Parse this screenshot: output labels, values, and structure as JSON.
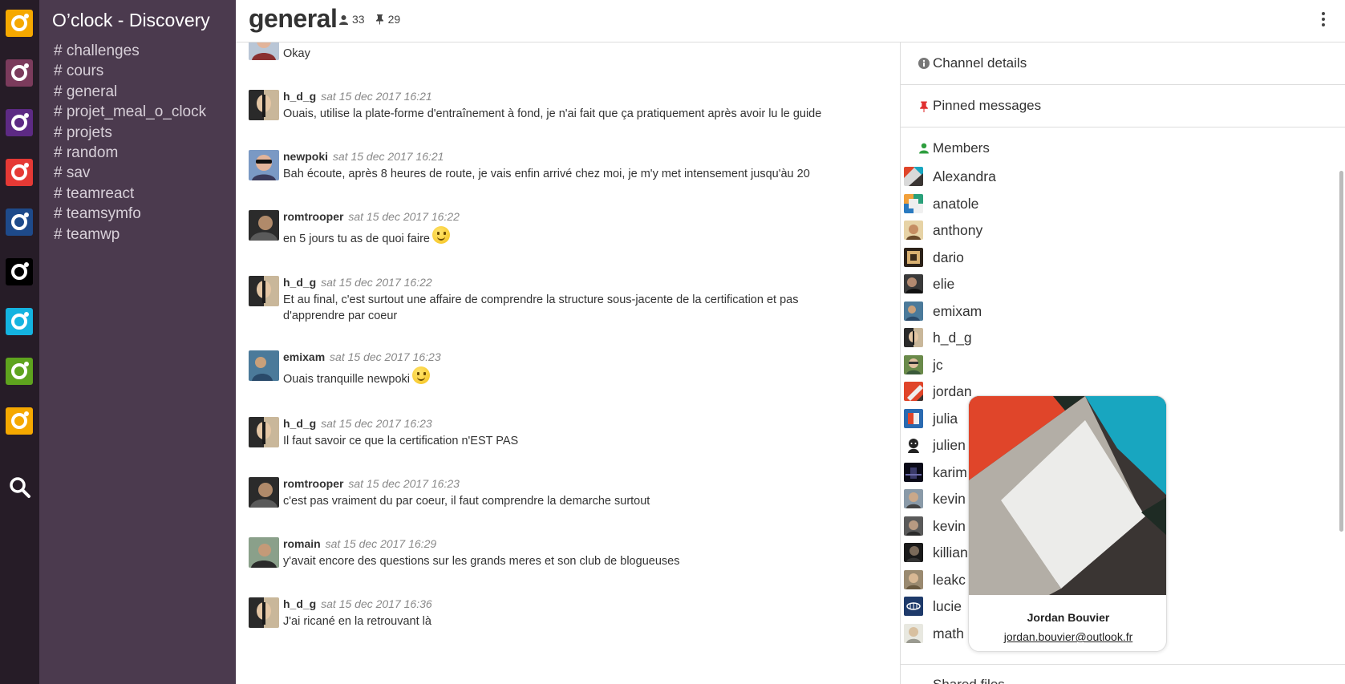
{
  "rail": {
    "teams": [
      {
        "name": "team-1",
        "color": "#f5a800"
      },
      {
        "name": "team-2",
        "color": "#7b3b5c"
      },
      {
        "name": "team-3",
        "color": "#5d2a84"
      },
      {
        "name": "team-4",
        "color": "#e53935"
      },
      {
        "name": "team-5",
        "color": "#1e4a8a"
      },
      {
        "name": "team-6",
        "color": "#000000"
      },
      {
        "name": "team-7",
        "color": "#14b3e0"
      },
      {
        "name": "team-8",
        "color": "#5ea31e"
      },
      {
        "name": "team-9",
        "color": "#f5a800"
      }
    ],
    "search_icon": "search-icon"
  },
  "sidebar": {
    "team_name": "O’clock - Discovery",
    "channels": [
      {
        "label": "# challenges"
      },
      {
        "label": "# cours"
      },
      {
        "label": "# general"
      },
      {
        "label": "# projet_meal_o_clock"
      },
      {
        "label": "# projets"
      },
      {
        "label": "# random"
      },
      {
        "label": "# sav"
      },
      {
        "label": "# teamreact"
      },
      {
        "label": "# teamsymfo"
      },
      {
        "label": "# teamwp"
      }
    ]
  },
  "header": {
    "title": "general",
    "members_count": "33",
    "pinned_count": "29",
    "menu_icon": "kebab-menu-icon"
  },
  "messages": [
    {
      "author": "",
      "time": "",
      "text": "Okay"
    },
    {
      "author": "h_d_g",
      "time": "sat 15 dec 2017 16:21",
      "text": "Ouais, utilise la plate-forme d'entraînement à fond, je n'ai fait que ça pratiquement après avoir lu le guide"
    },
    {
      "author": "newpoki",
      "time": "sat 15 dec 2017 16:21",
      "text": "Bah écoute, après 8 heures de route, je vais enfin arrivé chez moi, je m'y met intensement jusqu'àu 20"
    },
    {
      "author": "romtrooper",
      "time": "sat 15 dec 2017 16:22",
      "text": "en 5 jours tu as de quoi faire",
      "emoji": true
    },
    {
      "author": "h_d_g",
      "time": "sat 15 dec 2017 16:22",
      "text": "Et au final, c'est surtout une affaire de comprendre la structure sous-jacente de la certification et pas d'apprendre par coeur"
    },
    {
      "author": "emixam",
      "time": "sat 15 dec 2017 16:23",
      "text": "Ouais tranquille newpoki",
      "emoji": true
    },
    {
      "author": "h_d_g",
      "time": "sat 15 dec 2017 16:23",
      "text": "Il faut savoir ce que la certification n'EST PAS"
    },
    {
      "author": "romtrooper",
      "time": "sat 15 dec 2017 16:23",
      "text": "c'est pas vraiment du par coeur, il faut comprendre la demarche surtout"
    },
    {
      "author": "romain",
      "time": "sat 15 dec 2017 16:29",
      "text": "y'avait encore des questions sur les grands meres et son club de blogueuses"
    },
    {
      "author": "h_d_g",
      "time": "sat 15 dec 2017 16:36",
      "text": "J'ai ricané en la retrouvant là"
    }
  ],
  "panel": {
    "channel_details": "Channel details",
    "pinned_messages": "Pinned messages",
    "members_title": "Members",
    "members": [
      {
        "name": "Alexandra"
      },
      {
        "name": "anatole"
      },
      {
        "name": "anthony"
      },
      {
        "name": "dario"
      },
      {
        "name": "elie"
      },
      {
        "name": "emixam"
      },
      {
        "name": "h_d_g"
      },
      {
        "name": "jc"
      },
      {
        "name": "jordan"
      },
      {
        "name": "julia"
      },
      {
        "name": "julien"
      },
      {
        "name": "karim"
      },
      {
        "name": "kevin"
      },
      {
        "name": "kevin"
      },
      {
        "name": "killian"
      },
      {
        "name": "leakc"
      },
      {
        "name": "lucie"
      },
      {
        "name": "math"
      }
    ],
    "shared_files": "Shared files"
  },
  "popover": {
    "name": "Jordan Bouvier",
    "email": "jordan.bouvier@outlook.fr"
  },
  "colors": {
    "rail_bg": "#261c27",
    "sidebar_bg": "#4b3a4e",
    "channel_text": "#d8d0d9",
    "info_icon": "#777777",
    "pin_icon": "#e03030",
    "members_icon": "#2e9e3e"
  }
}
